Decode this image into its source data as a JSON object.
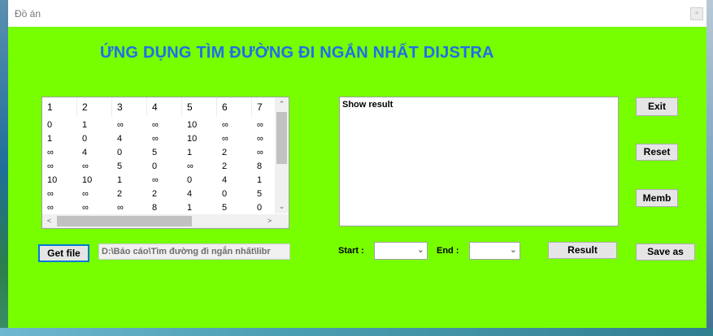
{
  "window": {
    "title": "Đồ án"
  },
  "app": {
    "heading": "ỨNG DỤNG TÌM ĐƯỜNG ĐI NGẮN NHẤT DIJSTRA"
  },
  "grid": {
    "headers": [
      "1",
      "2",
      "3",
      "4",
      "5",
      "6",
      "7"
    ],
    "rows": [
      [
        "0",
        "1",
        "∞",
        "∞",
        "10",
        "∞",
        "∞"
      ],
      [
        "1",
        "0",
        "4",
        "∞",
        "10",
        "∞",
        "∞"
      ],
      [
        "∞",
        "4",
        "0",
        "5",
        "1",
        "2",
        "∞"
      ],
      [
        "∞",
        "∞",
        "5",
        "0",
        "∞",
        "2",
        "8"
      ],
      [
        "10",
        "10",
        "1",
        "∞",
        "0",
        "4",
        "1"
      ],
      [
        "∞",
        "∞",
        "2",
        "2",
        "4",
        "0",
        "5"
      ],
      [
        "∞",
        "∞",
        "∞",
        "8",
        "1",
        "5",
        "0"
      ]
    ]
  },
  "result": {
    "text": "Show result"
  },
  "buttons": {
    "exit": "Exit",
    "reset": "Reset",
    "memb": "Memb",
    "get_file": "Get file",
    "result": "Result",
    "save_as": "Save as"
  },
  "file": {
    "path": "D:\\Báo cáo\\Tìm đường đi ngắn nhất\\libr"
  },
  "labels": {
    "start": "Start :",
    "end": "End :"
  },
  "selects": {
    "start_value": "",
    "end_value": ""
  },
  "icons": {
    "scroll_up": "⌃",
    "scroll_down": "⌄",
    "scroll_left": "<",
    "scroll_right": ">",
    "dropdown": "⌄",
    "window_control": "▫"
  }
}
